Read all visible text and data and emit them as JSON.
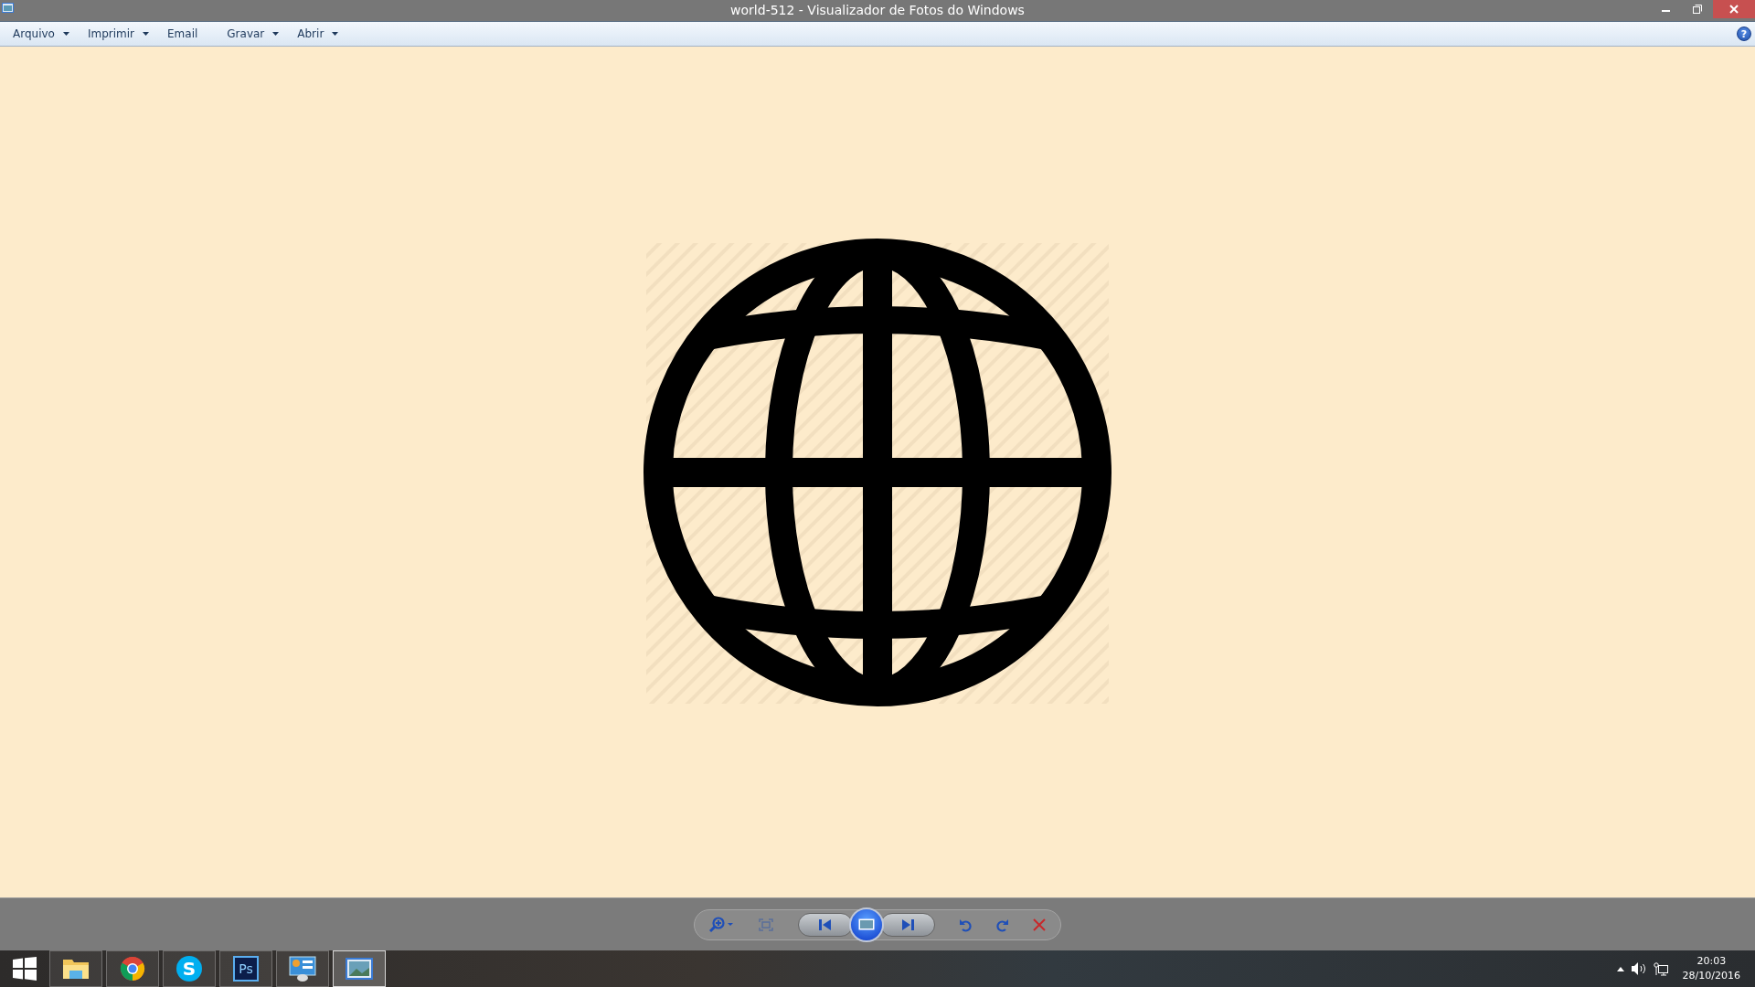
{
  "window": {
    "title": "world-512 - Visualizador de Fotos do Windows"
  },
  "help": {
    "label": "?"
  },
  "menu": [
    {
      "label": "Arquivo",
      "dropdown": true
    },
    {
      "label": "Imprimir",
      "dropdown": true
    },
    {
      "label": "Email",
      "dropdown": false
    },
    {
      "label": "Gravar",
      "dropdown": true
    },
    {
      "label": "Abrir",
      "dropdown": true
    }
  ],
  "taskbar": {
    "apps": [
      {
        "kind": "explorer",
        "selected": false
      },
      {
        "kind": "chrome",
        "selected": false
      },
      {
        "kind": "skype",
        "selected": false,
        "label": "S"
      },
      {
        "kind": "photoshop",
        "selected": false,
        "label": "Ps"
      },
      {
        "kind": "control",
        "selected": false
      },
      {
        "kind": "photos",
        "selected": true
      }
    ],
    "time": "20:03",
    "date": "28/10/2016"
  }
}
